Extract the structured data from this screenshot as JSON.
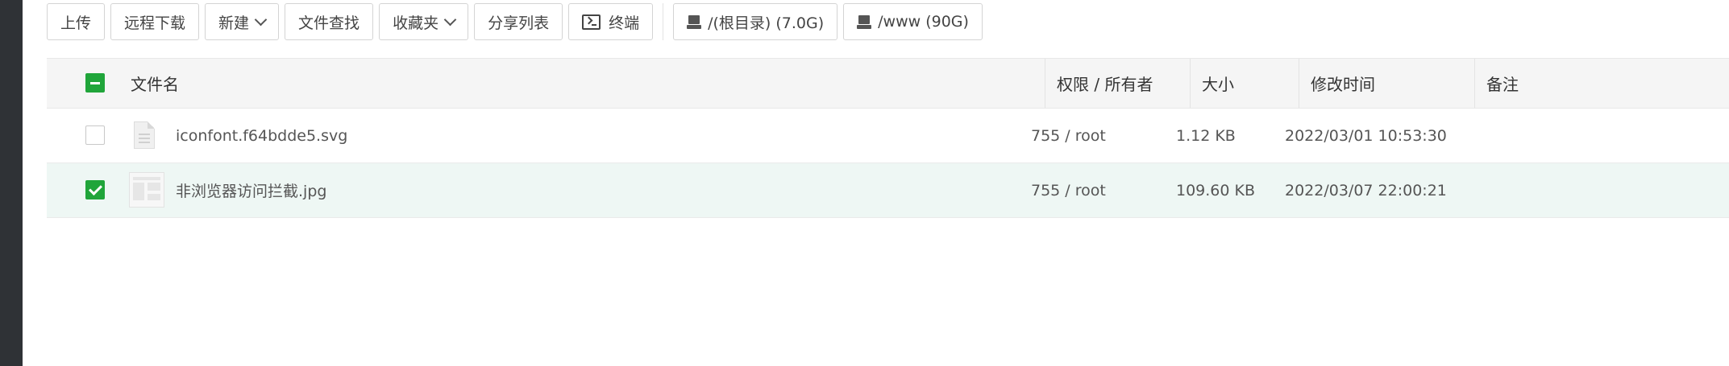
{
  "toolbar": {
    "upload": "上传",
    "remote_download": "远程下载",
    "new": "新建",
    "file_search": "文件查找",
    "favorites": "收藏夹",
    "share_list": "分享列表",
    "terminal": "终端",
    "disk_root": "/(根目录) (7.0G)",
    "disk_www": "/www (90G)"
  },
  "table": {
    "headers": {
      "name": "文件名",
      "permission": "权限 / 所有者",
      "size": "大小",
      "modified": "修改时间",
      "remark": "备注"
    },
    "rows": [
      {
        "name": "iconfont.f64bdde5.svg",
        "permission": "755 / root",
        "size": "1.12 KB",
        "modified": "2022/03/01 10:53:30",
        "remark": "",
        "checked": false,
        "icon": "file-icon"
      },
      {
        "name": "非浏览器访问拦截.jpg",
        "permission": "755 / root",
        "size": "109.60 KB",
        "modified": "2022/03/07 22:00:21",
        "remark": "",
        "checked": true,
        "icon": "image-thumbnail-icon"
      }
    ]
  },
  "colors": {
    "accent": "#20a53a",
    "selected_row": "#eef7f4",
    "header_bg": "#f5f5f5",
    "left_bar": "#2f3236"
  }
}
